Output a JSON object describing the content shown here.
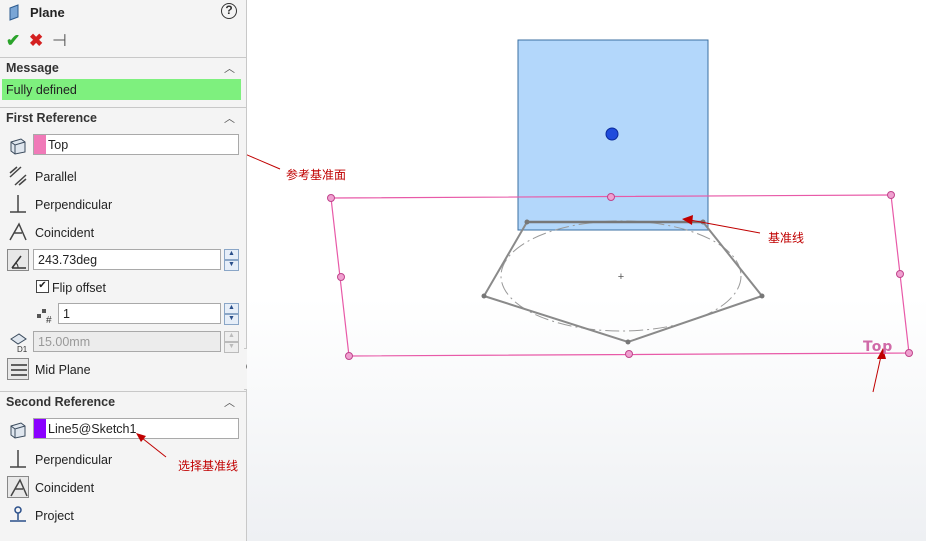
{
  "panel": {
    "title": "Plane",
    "help": "?",
    "actions": {
      "ok": "✔",
      "cancel": "✖",
      "pin": "⊣"
    },
    "message": {
      "header": "Message",
      "text": "Fully defined"
    },
    "first_reference": {
      "header": "First Reference",
      "selection": "Top",
      "selection_color": "#f07ab8",
      "options": {
        "parallel": "Parallel",
        "perpendicular": "Perpendicular",
        "coincident": "Coincident"
      },
      "angle": "243.73deg",
      "flip_offset": "Flip offset",
      "flip_offset_checked": true,
      "count": "1",
      "distance": "15.00mm",
      "mid_plane": "Mid Plane"
    },
    "second_reference": {
      "header": "Second Reference",
      "selection": "Line5@Sketch1",
      "selection_color": "#8a00ff",
      "options": {
        "perpendicular": "Perpendicular",
        "coincident": "Coincident",
        "project": "Project"
      }
    }
  },
  "viewport": {
    "plane_label": "Top",
    "annotations": {
      "ref_plane": "参考基准面",
      "datum_line": "基准线",
      "select_datum_line": "选择基准线"
    }
  },
  "colors": {
    "accent_pink": "#e85aa8",
    "new_plane_fill": "#b3d7fb",
    "message_ok": "#7ef07e",
    "annotation": "#c00000"
  }
}
